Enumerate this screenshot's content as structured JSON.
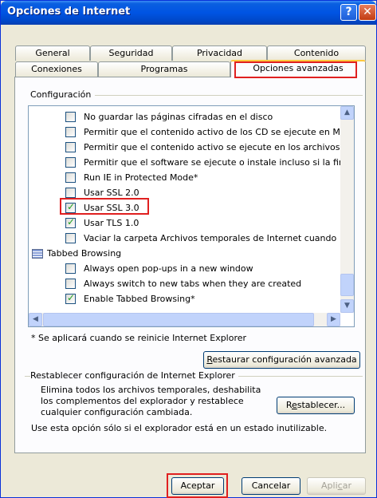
{
  "window": {
    "title": "Opciones de Internet"
  },
  "tabs_row1": [
    "General",
    "Seguridad",
    "Privacidad",
    "Contenido"
  ],
  "tabs_row2": [
    "Conexiones",
    "Programas",
    "Opciones avanzadas"
  ],
  "settings": {
    "group_label": "Configuración",
    "items": [
      {
        "label": "No guardar las páginas cifradas en el disco",
        "checked": false
      },
      {
        "label": "Permitir que el contenido activo de los CD se ejecute en M",
        "checked": false
      },
      {
        "label": "Permitir que el contenido activo se ejecute en los archivos",
        "checked": false
      },
      {
        "label": "Permitir que el software se ejecute o instale incluso si la fir",
        "checked": false
      },
      {
        "label": "Run IE in Protected Mode*",
        "checked": false
      },
      {
        "label": "Usar SSL 2.0",
        "checked": false
      },
      {
        "label": "Usar SSL 3.0",
        "checked": true
      },
      {
        "label": "Usar TLS 1.0",
        "checked": true
      },
      {
        "label": "Vaciar la carpeta Archivos temporales de Internet cuando",
        "checked": false
      }
    ],
    "category_label": "Tabbed Browsing",
    "sub_items": [
      {
        "label": "Always open pop-ups in a new window",
        "checked": false
      },
      {
        "label": "Always switch to new tabs when they are created",
        "checked": false
      },
      {
        "label": "Enable Tabbed Browsing*",
        "checked": true
      }
    ],
    "restart_note": "* Se aplicará cuando se reinicie Internet Explorer",
    "restore_button": {
      "before": "",
      "underlined": "R",
      "after": "estaurar configuración avanzada"
    }
  },
  "reset": {
    "group_label": "Restablecer configuración de Internet Explorer",
    "description_lines": [
      "Elimina todos los archivos temporales, deshabilita",
      "los complementos del explorador y restablece",
      "cualquier configuración cambiada."
    ],
    "note": "Use esta opción sólo si el explorador está en un estado inutilizable.",
    "reset_button": {
      "before": "R",
      "underlined": "e",
      "after": "stablecer..."
    }
  },
  "footer": {
    "accept": "Aceptar",
    "cancel": "Cancelar",
    "apply": {
      "before": "Apli",
      "underlined": "c",
      "after": "ar"
    }
  },
  "colors": {
    "highlight": "#e02020",
    "titlebar": "#0054e3",
    "check": "#21a121"
  }
}
